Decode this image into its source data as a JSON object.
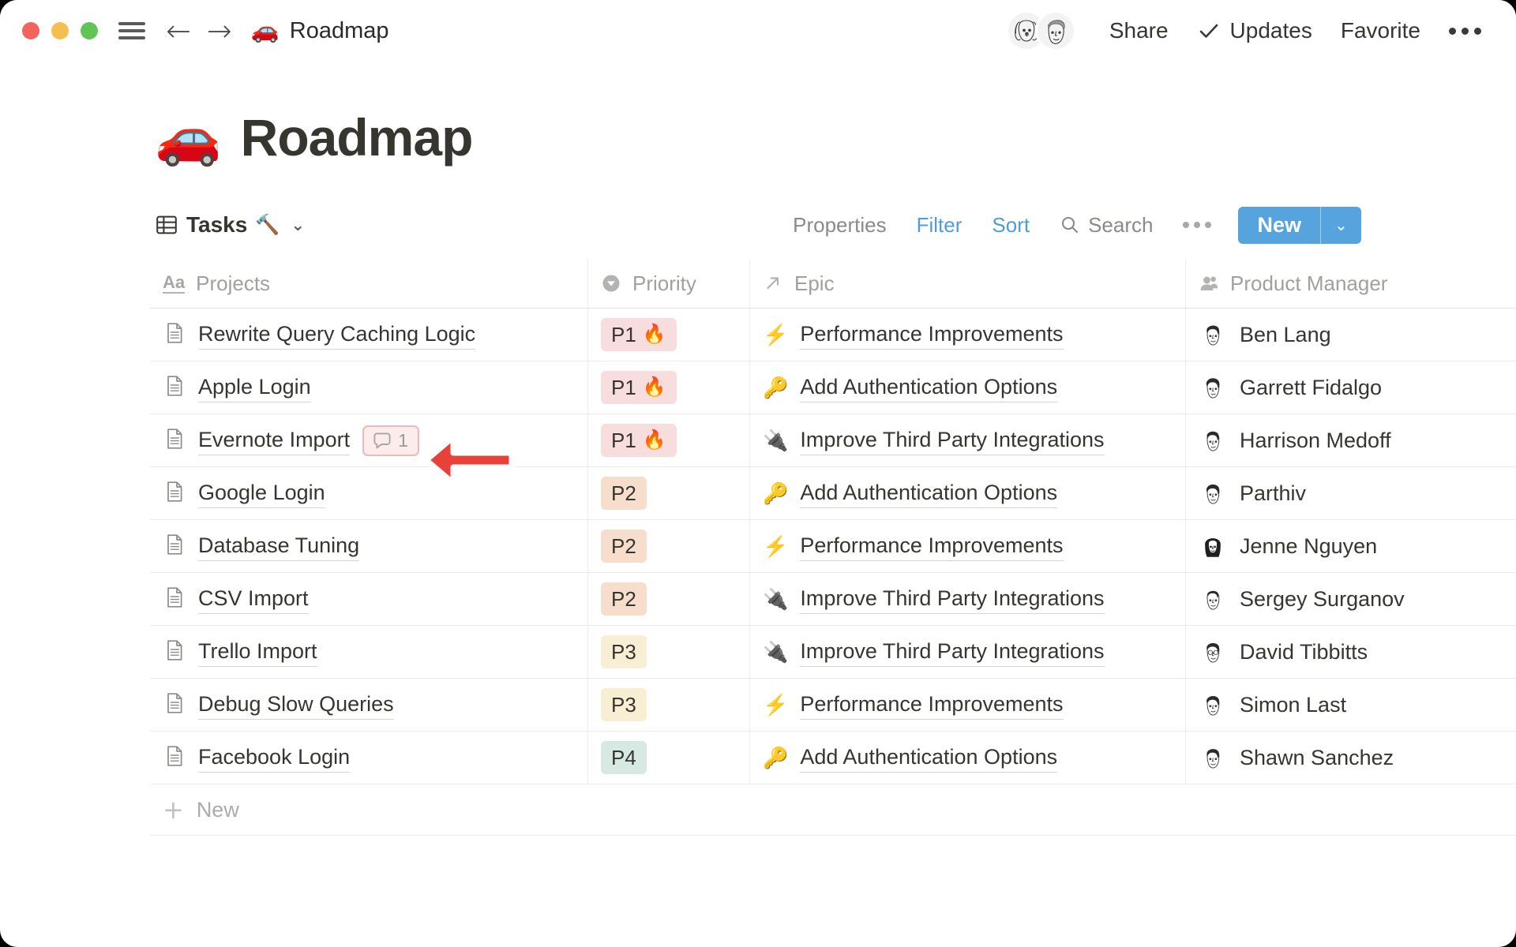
{
  "window": {
    "traffic_lights": [
      "close",
      "minimize",
      "maximize"
    ],
    "colors": {
      "close": "#f1655d",
      "minimize": "#f5bf4f",
      "maximize": "#61c555",
      "accent_blue": "#57a3dd",
      "link_blue": "#529cd5",
      "text": "#37352f",
      "muted": "#a2a09c"
    }
  },
  "titlebar": {
    "breadcrumb_emoji": "🚗",
    "breadcrumb_label": "Roadmap",
    "share_label": "Share",
    "updates_label": "Updates",
    "updates_check": "✓",
    "favorite_label": "Favorite",
    "more_label": "•••",
    "avatars": [
      {
        "name": "dog-avatar"
      },
      {
        "name": "person-avatar"
      }
    ]
  },
  "page": {
    "icon": "🚗",
    "title": "Roadmap"
  },
  "view_toolbar": {
    "view_name": "Tasks",
    "view_emoji": "🔨",
    "view_caret": "⌄",
    "properties_label": "Properties",
    "filter_label": "Filter",
    "sort_label": "Sort",
    "search_label": "Search",
    "more_label": "•••",
    "new_label": "New",
    "new_caret": "⌄"
  },
  "table": {
    "columns": [
      {
        "label": "Projects",
        "icon": "text-aa-icon"
      },
      {
        "label": "Priority",
        "icon": "select-chevron-icon"
      },
      {
        "label": "Epic",
        "icon": "relation-arrow-icon"
      },
      {
        "label": "Product Manager",
        "icon": "person-icon"
      }
    ],
    "rows": [
      {
        "project": "Rewrite Query Caching Logic",
        "comments": null,
        "priority": "P1",
        "priority_emoji": "🔥",
        "priority_color": "#f7dddd",
        "epic": "Performance Improvements",
        "epic_emoji": "⚡",
        "pm": "Ben Lang"
      },
      {
        "project": "Apple Login",
        "comments": null,
        "priority": "P1",
        "priority_emoji": "🔥",
        "priority_color": "#f7dddd",
        "epic": "Add Authentication Options",
        "epic_emoji": "🔑",
        "pm": "Garrett Fidalgo"
      },
      {
        "project": "Evernote Import",
        "comments": "1",
        "priority": "P1",
        "priority_emoji": "🔥",
        "priority_color": "#f7dddd",
        "epic": "Improve Third Party Integrations",
        "epic_emoji": "🔌",
        "pm": "Harrison Medoff"
      },
      {
        "project": "Google Login",
        "comments": null,
        "priority": "P2",
        "priority_emoji": "",
        "priority_color": "#f6ddcc",
        "epic": "Add Authentication Options",
        "epic_emoji": "🔑",
        "pm": "Parthiv"
      },
      {
        "project": "Database Tuning",
        "comments": null,
        "priority": "P2",
        "priority_emoji": "",
        "priority_color": "#f6ddcc",
        "epic": "Performance Improvements",
        "epic_emoji": "⚡",
        "pm": "Jenne Nguyen"
      },
      {
        "project": "CSV Import",
        "comments": null,
        "priority": "P2",
        "priority_emoji": "",
        "priority_color": "#f6ddcc",
        "epic": "Improve Third Party Integrations",
        "epic_emoji": "🔌",
        "pm": "Sergey Surganov"
      },
      {
        "project": "Trello Import",
        "comments": null,
        "priority": "P3",
        "priority_emoji": "",
        "priority_color": "#f8eed3",
        "epic": "Improve Third Party Integrations",
        "epic_emoji": "🔌",
        "pm": "David Tibbitts"
      },
      {
        "project": "Debug Slow Queries",
        "comments": null,
        "priority": "P3",
        "priority_emoji": "",
        "priority_color": "#f8eed3",
        "epic": "Performance Improvements",
        "epic_emoji": "⚡",
        "pm": "Simon Last"
      },
      {
        "project": "Facebook Login",
        "comments": null,
        "priority": "P4",
        "priority_emoji": "",
        "priority_color": "#d6e9e2",
        "epic": "Add Authentication Options",
        "epic_emoji": "🔑",
        "pm": "Shawn Sanchez"
      }
    ],
    "new_row_label": "New",
    "new_row_plus": "+"
  },
  "annotation": {
    "type": "red-arrow-left",
    "color": "#e8403a",
    "points_at": "comment-badge-evernote-import"
  }
}
